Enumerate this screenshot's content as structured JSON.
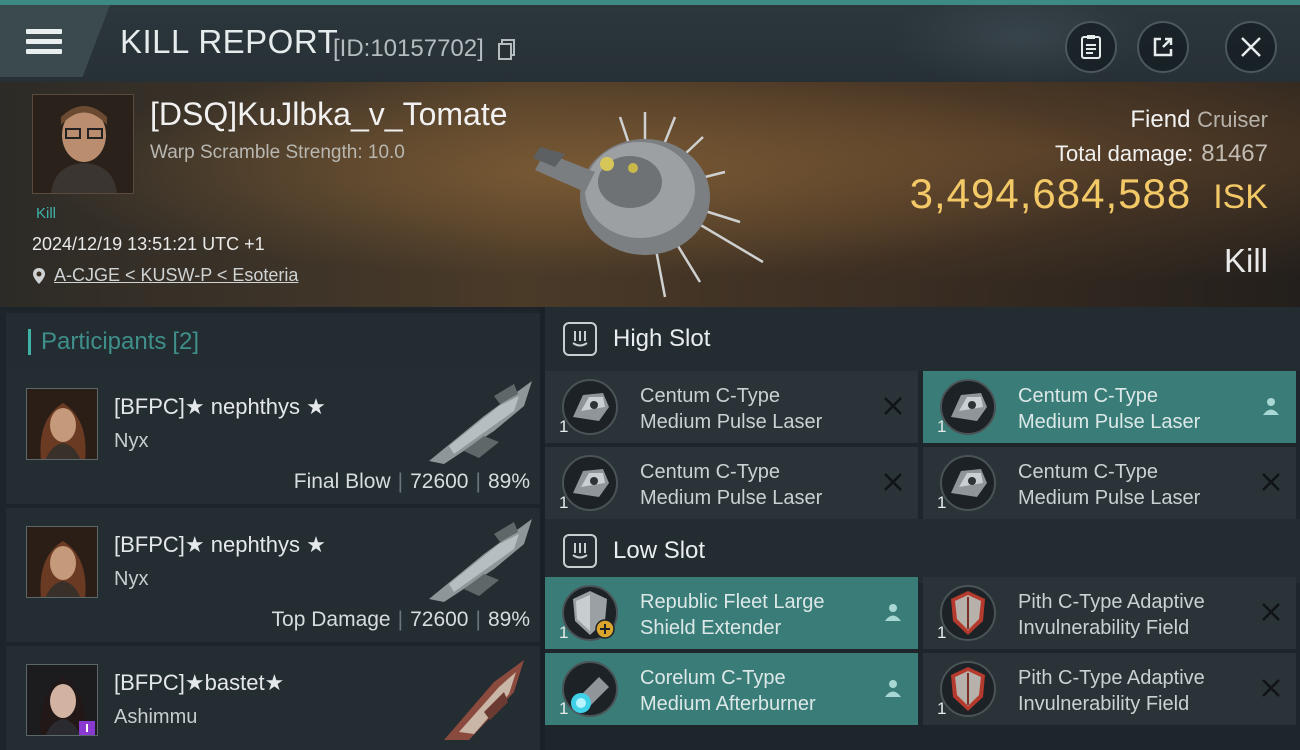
{
  "header": {
    "title": "KILL REPORT",
    "kill_id": "[ID:10157702]",
    "icons": [
      "menu-icon",
      "copy-icon",
      "clipboard-icon",
      "share-icon",
      "close-icon"
    ]
  },
  "victim": {
    "name": "[DSQ]KuJlbka_v_Tomate",
    "warp_scramble": "Warp Scramble Strength: 10.0",
    "kill_tag": "Kill",
    "timestamp": "2024/12/19 13:51:21 UTC +1",
    "location": "A-CJGE < KUSW-P < Esoteria",
    "ship_name": "Fiend",
    "ship_class": "Cruiser",
    "total_damage_label": "Total damage:",
    "total_damage": "81467",
    "isk_value": "3,494,684,588",
    "isk_unit": "ISK",
    "result": "Kill"
  },
  "participants": {
    "title": "Participants",
    "count": "[2]",
    "rows": [
      {
        "name": "[BFPC]★ nephthys ★",
        "ship": "Nyx",
        "role": "Final Blow",
        "damage": "72600",
        "percent": "89%"
      },
      {
        "name": "[BFPC]★ nephthys ★",
        "ship": "Nyx",
        "role": "Top Damage",
        "damage": "72600",
        "percent": "89%"
      },
      {
        "name": "[BFPC]★bastet★",
        "ship": "Ashimmu",
        "role": "",
        "damage": "",
        "percent": ""
      }
    ]
  },
  "fitting": {
    "high_slot": {
      "title": "High Slot",
      "modules": [
        {
          "line1": "Centum C-Type",
          "line2": "Medium Pulse Laser",
          "qty": "1",
          "status": "destroyed"
        },
        {
          "line1": "Centum C-Type",
          "line2": "Medium Pulse Laser",
          "qty": "1",
          "status": "dropped"
        },
        {
          "line1": "Centum C-Type",
          "line2": "Medium Pulse Laser",
          "qty": "1",
          "status": "destroyed"
        },
        {
          "line1": "Centum C-Type",
          "line2": "Medium Pulse Laser",
          "qty": "1",
          "status": "destroyed"
        }
      ]
    },
    "low_slot": {
      "title": "Low Slot",
      "modules": [
        {
          "line1": "Republic Fleet Large",
          "line2": "Shield Extender",
          "qty": "1",
          "status": "dropped"
        },
        {
          "line1": "Pith C-Type Adaptive",
          "line2": "Invulnerability Field",
          "qty": "1",
          "status": "destroyed"
        },
        {
          "line1": "Corelum C-Type",
          "line2": "Medium Afterburner",
          "qty": "1",
          "status": "dropped"
        },
        {
          "line1": "Pith C-Type Adaptive",
          "line2": "Invulnerability Field",
          "qty": "1",
          "status": "destroyed"
        }
      ]
    }
  },
  "colors": {
    "accent": "#3fb3a8",
    "isk": "#f3c867",
    "owned_module": "#3a7d78"
  }
}
